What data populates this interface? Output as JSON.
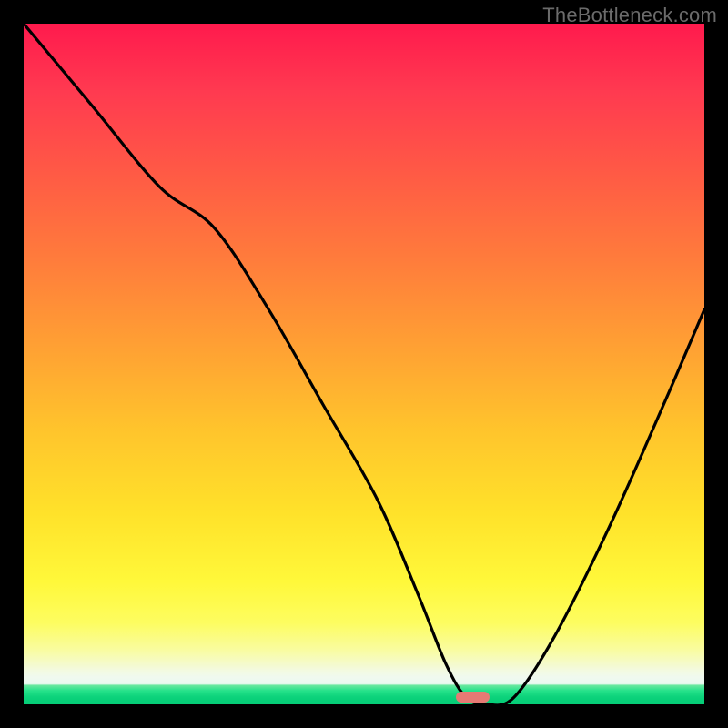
{
  "watermark": "TheBottleneck.com",
  "chart_data": {
    "type": "line",
    "title": "",
    "xlabel": "",
    "ylabel": "",
    "xlim": [
      0,
      100
    ],
    "ylim": [
      0,
      100
    ],
    "series": [
      {
        "name": "bottleneck-curve",
        "x": [
          0,
          10,
          20,
          28,
          36,
          44,
          52,
          58,
          62,
          65,
          68,
          72,
          78,
          86,
          94,
          100
        ],
        "y": [
          100,
          88,
          76,
          70,
          58,
          44,
          30,
          16,
          6,
          1,
          0,
          1,
          10,
          26,
          44,
          58
        ]
      }
    ],
    "marker": {
      "x_center": 66,
      "y": 0,
      "width_pct": 5
    },
    "background_gradient": {
      "top_color": "#ff1a4d",
      "mid_color": "#ffe22a",
      "band_pale": "#f0f9ef",
      "bottom_color": "#06cd77"
    },
    "colors": {
      "curve": "#000000",
      "frame": "#000000",
      "marker": "#e67a74",
      "watermark": "#6b6b6b"
    }
  }
}
